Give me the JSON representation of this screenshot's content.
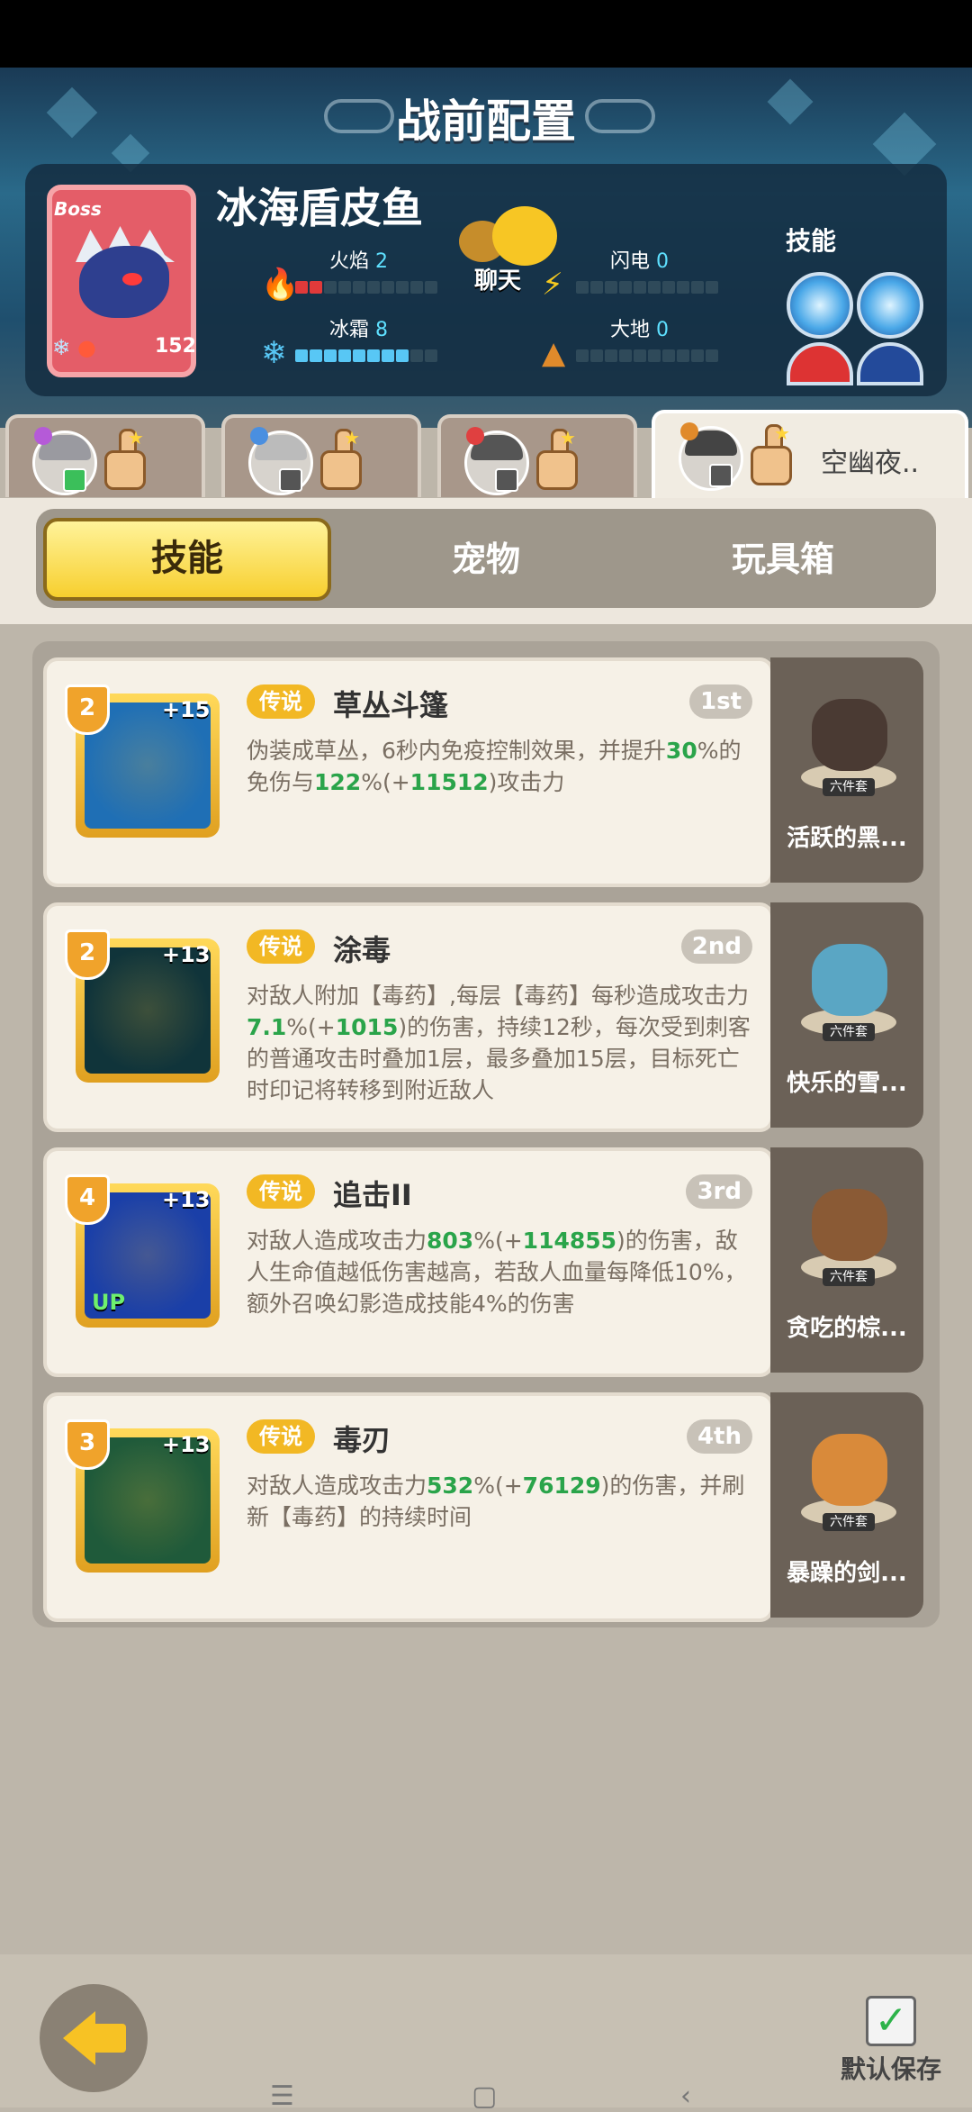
{
  "title": "战前配置",
  "boss": {
    "badge": "Boss",
    "name": "冰海盾皮鱼",
    "level": "152",
    "stats": [
      {
        "label": "火焰",
        "value": "2",
        "icon": "fire-icon",
        "filled": 2,
        "color": "#e13a3a"
      },
      {
        "label": "闪电",
        "value": "0",
        "icon": "lightning-icon",
        "filled": 0,
        "color": "#f5c91f"
      },
      {
        "label": "冰霜",
        "value": "8",
        "icon": "snowflake-icon",
        "filled": 8,
        "color": "#58c7f5"
      },
      {
        "label": "大地",
        "value": "0",
        "icon": "earth-icon",
        "filled": 0,
        "color": "#e08a2b"
      }
    ],
    "chat_label": "聊天",
    "skills_label": "技能"
  },
  "heroes": [
    {
      "name": "",
      "active": false
    },
    {
      "name": "",
      "active": false
    },
    {
      "name": "",
      "active": false
    },
    {
      "name": "空幽夜..",
      "active": true
    }
  ],
  "tabs": {
    "skills": "技能",
    "pets": "宠物",
    "toybox": "玩具箱"
  },
  "skill_cards": [
    {
      "level": "2",
      "plus": "+15",
      "rarity": "传说",
      "name": "草丛斗篷",
      "rank": "1st",
      "desc": [
        {
          "t": "伪装成草丛，6秒内免疫控制效果，并提升",
          "g": false
        },
        {
          "t": "30",
          "g": true
        },
        {
          "t": "%的免伤与",
          "g": false
        },
        {
          "t": "122",
          "g": true
        },
        {
          "t": "%(+",
          "g": false
        },
        {
          "t": "11512",
          "g": true
        },
        {
          "t": ")攻击力",
          "g": false
        }
      ],
      "pet_name": "活跃的黑...",
      "pet_tag": "六件套",
      "icon_color": "#1f6fb5",
      "pet_color": "#4a3a33"
    },
    {
      "level": "2",
      "plus": "+13",
      "rarity": "传说",
      "name": "涂毒",
      "rank": "2nd",
      "desc": [
        {
          "t": "对敌人附加【毒药】,每层【毒药】每秒造成攻击力",
          "g": false
        },
        {
          "t": "7.1",
          "g": true
        },
        {
          "t": "%(+",
          "g": false
        },
        {
          "t": "1015",
          "g": true
        },
        {
          "t": ")的伤害，持续12秒，每次受到刺客的普通攻击时叠加1层，最多叠加15层，目标死亡时印记将转移到附近敌人",
          "g": false
        }
      ],
      "pet_name": "快乐的雪...",
      "pet_tag": "六件套",
      "icon_color": "#10343a",
      "pet_color": "#5aa6c4"
    },
    {
      "level": "4",
      "plus": "+13",
      "rarity": "传说",
      "name": "追击II",
      "rank": "3rd",
      "desc": [
        {
          "t": "对敌人造成攻击力",
          "g": false
        },
        {
          "t": "803",
          "g": true
        },
        {
          "t": "%(+",
          "g": false
        },
        {
          "t": "114855",
          "g": true
        },
        {
          "t": ")的伤害，敌人生命值越低伤害越高，若敌人血量每降低10%，额外召唤幻影造成技能4%的伤害",
          "g": false
        }
      ],
      "pet_name": "贪吃的棕...",
      "pet_tag": "六件套",
      "icon_color": "#1a3fa8",
      "pet_color": "#8a5a35",
      "up": "UP"
    },
    {
      "level": "3",
      "plus": "+13",
      "rarity": "传说",
      "name": "毒刃",
      "rank": "4th",
      "desc": [
        {
          "t": "对敌人造成攻击力",
          "g": false
        },
        {
          "t": "532",
          "g": true
        },
        {
          "t": "%(+",
          "g": false
        },
        {
          "t": "76129",
          "g": true
        },
        {
          "t": ")的伤害，并刷新【毒药】的持续时间",
          "g": false
        }
      ],
      "pet_name": "暴躁的剑...",
      "pet_tag": "六件套",
      "icon_color": "#1f5a3a",
      "pet_color": "#d98a3a"
    }
  ],
  "bottom": {
    "save_label": "默认保存"
  }
}
